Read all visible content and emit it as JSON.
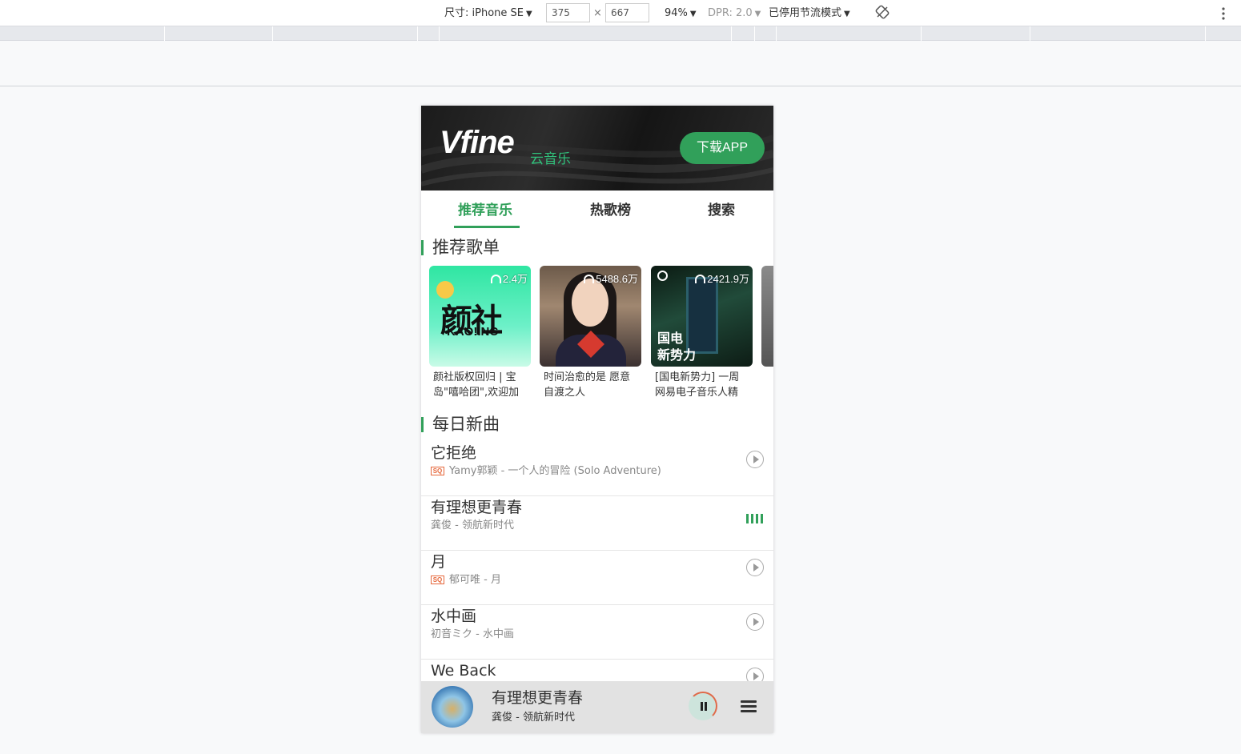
{
  "devtools": {
    "device_label": "尺寸: iPhone SE",
    "width_value": "375",
    "times": "×",
    "height_value": "667",
    "zoom": "94%",
    "dpr": "DPR: 2.0",
    "throttle": "已停用节流模式",
    "caret": "▼"
  },
  "header": {
    "logo": "Vfine",
    "subtitle": "云音乐",
    "download_label": "下载APP"
  },
  "tabs": [
    {
      "label": "推荐音乐",
      "active": true
    },
    {
      "label": "热歌榜",
      "active": false
    },
    {
      "label": "搜索",
      "active": false
    }
  ],
  "recommend": {
    "title": "推荐歌单",
    "playlists": [
      {
        "count": "2.4万",
        "name": "颜社版权回归 | 宝岛\"嘻哈团\",欢迎加",
        "cover_text_big": "颜社",
        "cover_text_small": "KAO!INC"
      },
      {
        "count": "5488.6万",
        "name": "时间治愈的是 愿意自渡之人"
      },
      {
        "count": "2421.9万",
        "name": "[国电新势力] 一周网易电子音乐人精",
        "cover_text": "国电\n新势力"
      },
      {
        "count": "",
        "name": ""
      }
    ]
  },
  "daily": {
    "title": "每日新曲",
    "sq_badge": "SQ",
    "songs": [
      {
        "title": "它拒绝",
        "sub": "Yamy郭颖 - 一个人的冒险 (Solo Adventure)",
        "sq": true,
        "playing": false
      },
      {
        "title": "有理想更青春",
        "sub": "龚俊 - 领航新时代",
        "sq": false,
        "playing": true
      },
      {
        "title": "月",
        "sub": "郁可唯 - 月",
        "sq": true,
        "playing": false
      },
      {
        "title": "水中画",
        "sub": "初音ミク - 水中画",
        "sq": false,
        "playing": false
      },
      {
        "title": "We Back",
        "sub": "",
        "sq": false,
        "playing": false
      }
    ]
  },
  "player": {
    "title": "有理想更青春",
    "sub": "龚俊 - 领航新时代"
  },
  "colors": {
    "accent": "#31a05a",
    "sq": "#e6683c"
  }
}
